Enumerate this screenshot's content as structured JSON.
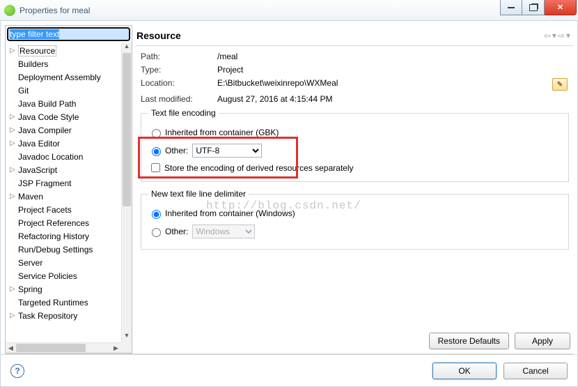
{
  "window": {
    "title": "Properties for meal"
  },
  "filter": {
    "placeholder": "type filter text",
    "value": "type filter text"
  },
  "tree": {
    "items": [
      {
        "label": "Resource",
        "expandable": true,
        "selected": true
      },
      {
        "label": "Builders",
        "expandable": false
      },
      {
        "label": "Deployment Assembly",
        "expandable": false
      },
      {
        "label": "Git",
        "expandable": false
      },
      {
        "label": "Java Build Path",
        "expandable": false
      },
      {
        "label": "Java Code Style",
        "expandable": true
      },
      {
        "label": "Java Compiler",
        "expandable": true
      },
      {
        "label": "Java Editor",
        "expandable": true
      },
      {
        "label": "Javadoc Location",
        "expandable": false
      },
      {
        "label": "JavaScript",
        "expandable": true
      },
      {
        "label": "JSP Fragment",
        "expandable": false
      },
      {
        "label": "Maven",
        "expandable": true
      },
      {
        "label": "Project Facets",
        "expandable": false
      },
      {
        "label": "Project References",
        "expandable": false
      },
      {
        "label": "Refactoring History",
        "expandable": false
      },
      {
        "label": "Run/Debug Settings",
        "expandable": false
      },
      {
        "label": "Server",
        "expandable": false
      },
      {
        "label": "Service Policies",
        "expandable": false
      },
      {
        "label": "Spring",
        "expandable": true
      },
      {
        "label": "Targeted Runtimes",
        "expandable": false
      },
      {
        "label": "Task Repository",
        "expandable": true
      }
    ]
  },
  "page": {
    "heading": "Resource",
    "path_label": "Path:",
    "path_value": "/meal",
    "type_label": "Type:",
    "type_value": "Project",
    "location_label": "Location:",
    "location_value": "E:\\Bitbucket\\weixinrepo\\WXMeal",
    "modified_label": "Last modified:",
    "modified_value": "August 27, 2016 at 4:15:44 PM",
    "encoding": {
      "legend": "Text file encoding",
      "inherited_label": "Inherited from container (GBK)",
      "other_label": "Other:",
      "other_value": "UTF-8",
      "store_label": "Store the encoding of derived resources separately"
    },
    "delimiter": {
      "legend": "New text file line delimiter",
      "inherited_label": "Inherited from container (Windows)",
      "other_label": "Other:",
      "other_value": "Windows"
    },
    "restore": "Restore Defaults",
    "apply": "Apply"
  },
  "watermark": "http://blog.csdn.net/",
  "dialog": {
    "ok": "OK",
    "cancel": "Cancel"
  }
}
